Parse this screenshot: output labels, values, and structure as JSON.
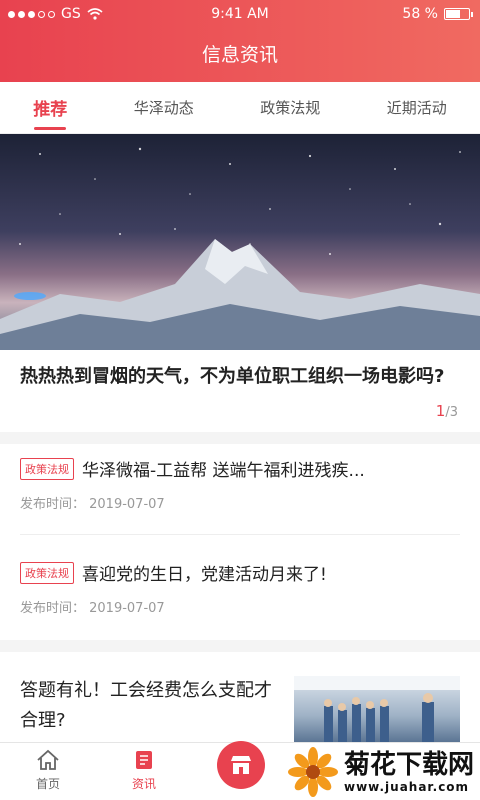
{
  "status": {
    "carrier": "GS",
    "time": "9:41 AM",
    "battery": "58 %",
    "battery_level": 0.58
  },
  "header": {
    "title": "信息资讯"
  },
  "tabs": [
    {
      "label": "推荐",
      "active": true
    },
    {
      "label": "华泽动态"
    },
    {
      "label": "政策法规"
    },
    {
      "label": "近期活动"
    }
  ],
  "headline": {
    "text": "热热热到冒烟的天气，不为单位职工组织一场电影吗?",
    "pager_current": "1",
    "pager_total": "/3"
  },
  "news": [
    {
      "tag": "政策法规",
      "title": "华泽微福-工益帮 送端午福利进残疾...",
      "date": "发布时间：  2019-07-07"
    },
    {
      "tag": "政策法规",
      "title": "喜迎党的生日，党建活动月来了!",
      "date": "发布时间：  2019-07-07"
    }
  ],
  "feature": {
    "text": "答题有礼！工会经费怎么支配才合理?"
  },
  "nav": [
    {
      "label": "首页",
      "icon": "home-icon"
    },
    {
      "label": "资讯",
      "icon": "news-icon",
      "active": true
    },
    {
      "label": "",
      "icon": "store-icon"
    }
  ],
  "watermark": {
    "text": "菊花下载网",
    "url": "www.juahar.com"
  },
  "colors": {
    "accent": "#e8424f"
  }
}
